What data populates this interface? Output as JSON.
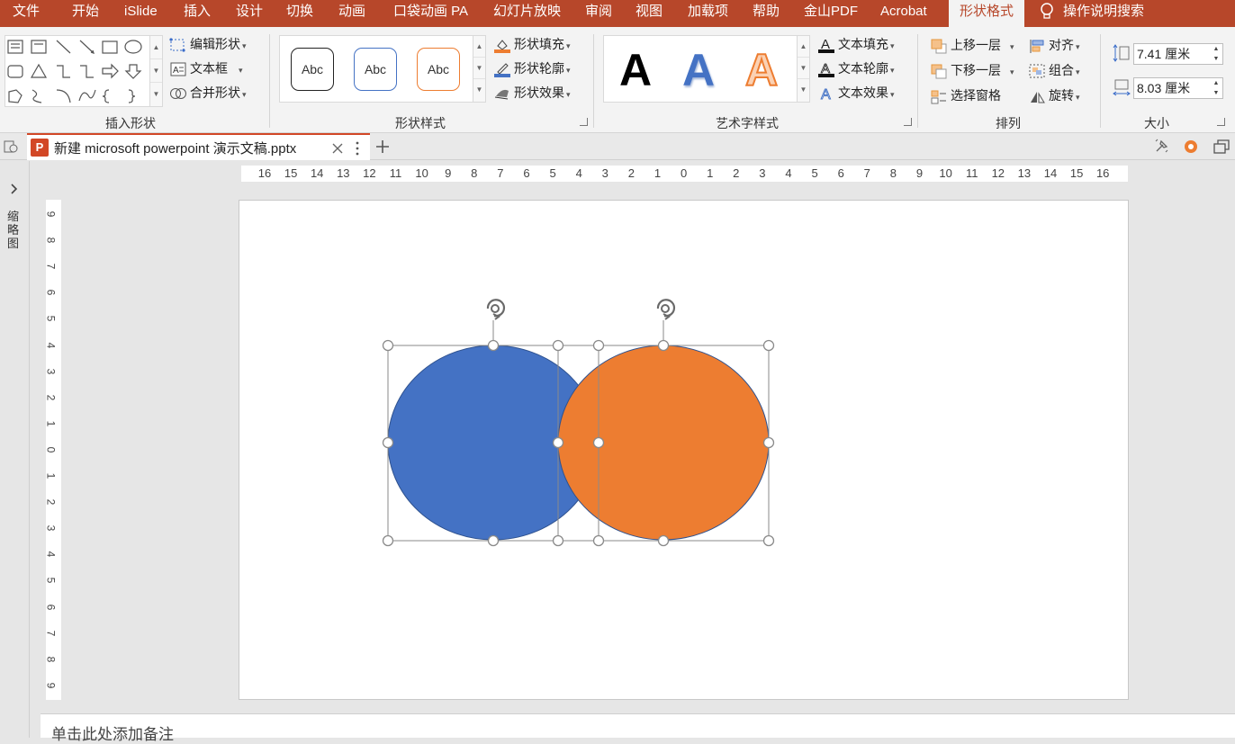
{
  "menu": {
    "tabs": [
      "文件",
      "开始",
      "iSlide",
      "插入",
      "设计",
      "切换",
      "动画",
      "口袋动画 PA",
      "幻灯片放映",
      "审阅",
      "视图",
      "加载项",
      "帮助",
      "金山PDF",
      "Acrobat",
      "形状格式"
    ],
    "active_tab": "形状格式",
    "search_label": "操作说明搜索"
  },
  "ribbon": {
    "insert_shapes": {
      "label": "插入形状",
      "edit_shape": "编辑形状",
      "text_box": "文本框",
      "merge_shapes": "合并形状"
    },
    "shape_styles": {
      "label": "形状样式",
      "thumb_text": "Abc",
      "shape_fill": "形状填充",
      "shape_outline": "形状轮廓",
      "shape_effects": "形状效果"
    },
    "wordart_styles": {
      "label": "艺术字样式",
      "glyph": "A",
      "text_fill": "文本填充",
      "text_outline": "文本轮廓",
      "text_effects": "文本效果"
    },
    "arrange": {
      "label": "排列",
      "bring_forward": "上移一层",
      "send_backward": "下移一层",
      "selection_pane": "选择窗格",
      "align": "对齐",
      "group": "组合",
      "rotate": "旋转"
    },
    "size": {
      "label": "大小",
      "height": "7.41 厘米",
      "width": "8.03 厘米"
    }
  },
  "document": {
    "tab_title": "新建 microsoft powerpoint 演示文稿.pptx",
    "ppt_icon_letter": "P"
  },
  "left_panel": {
    "label": "缩略图"
  },
  "rulers": {
    "horizontal": [
      "16",
      "15",
      "14",
      "13",
      "12",
      "11",
      "10",
      "9",
      "8",
      "7",
      "6",
      "5",
      "4",
      "3",
      "2",
      "1",
      "0",
      "1",
      "2",
      "3",
      "4",
      "5",
      "6",
      "7",
      "8",
      "9",
      "10",
      "11",
      "12",
      "13",
      "14",
      "15",
      "16"
    ],
    "vertical": [
      "9",
      "8",
      "7",
      "6",
      "5",
      "4",
      "3",
      "2",
      "1",
      "0",
      "1",
      "2",
      "3",
      "4",
      "5",
      "6",
      "7",
      "8",
      "9"
    ]
  },
  "slide": {
    "shapes": [
      {
        "type": "ellipse",
        "fill": "#4472c4"
      },
      {
        "type": "ellipse",
        "fill": "#ed7d31"
      }
    ]
  },
  "notes": {
    "placeholder": "单击此处添加备注"
  },
  "colors": {
    "accent": "#b7472a",
    "blue": "#4472c4",
    "orange": "#ed7d31"
  }
}
